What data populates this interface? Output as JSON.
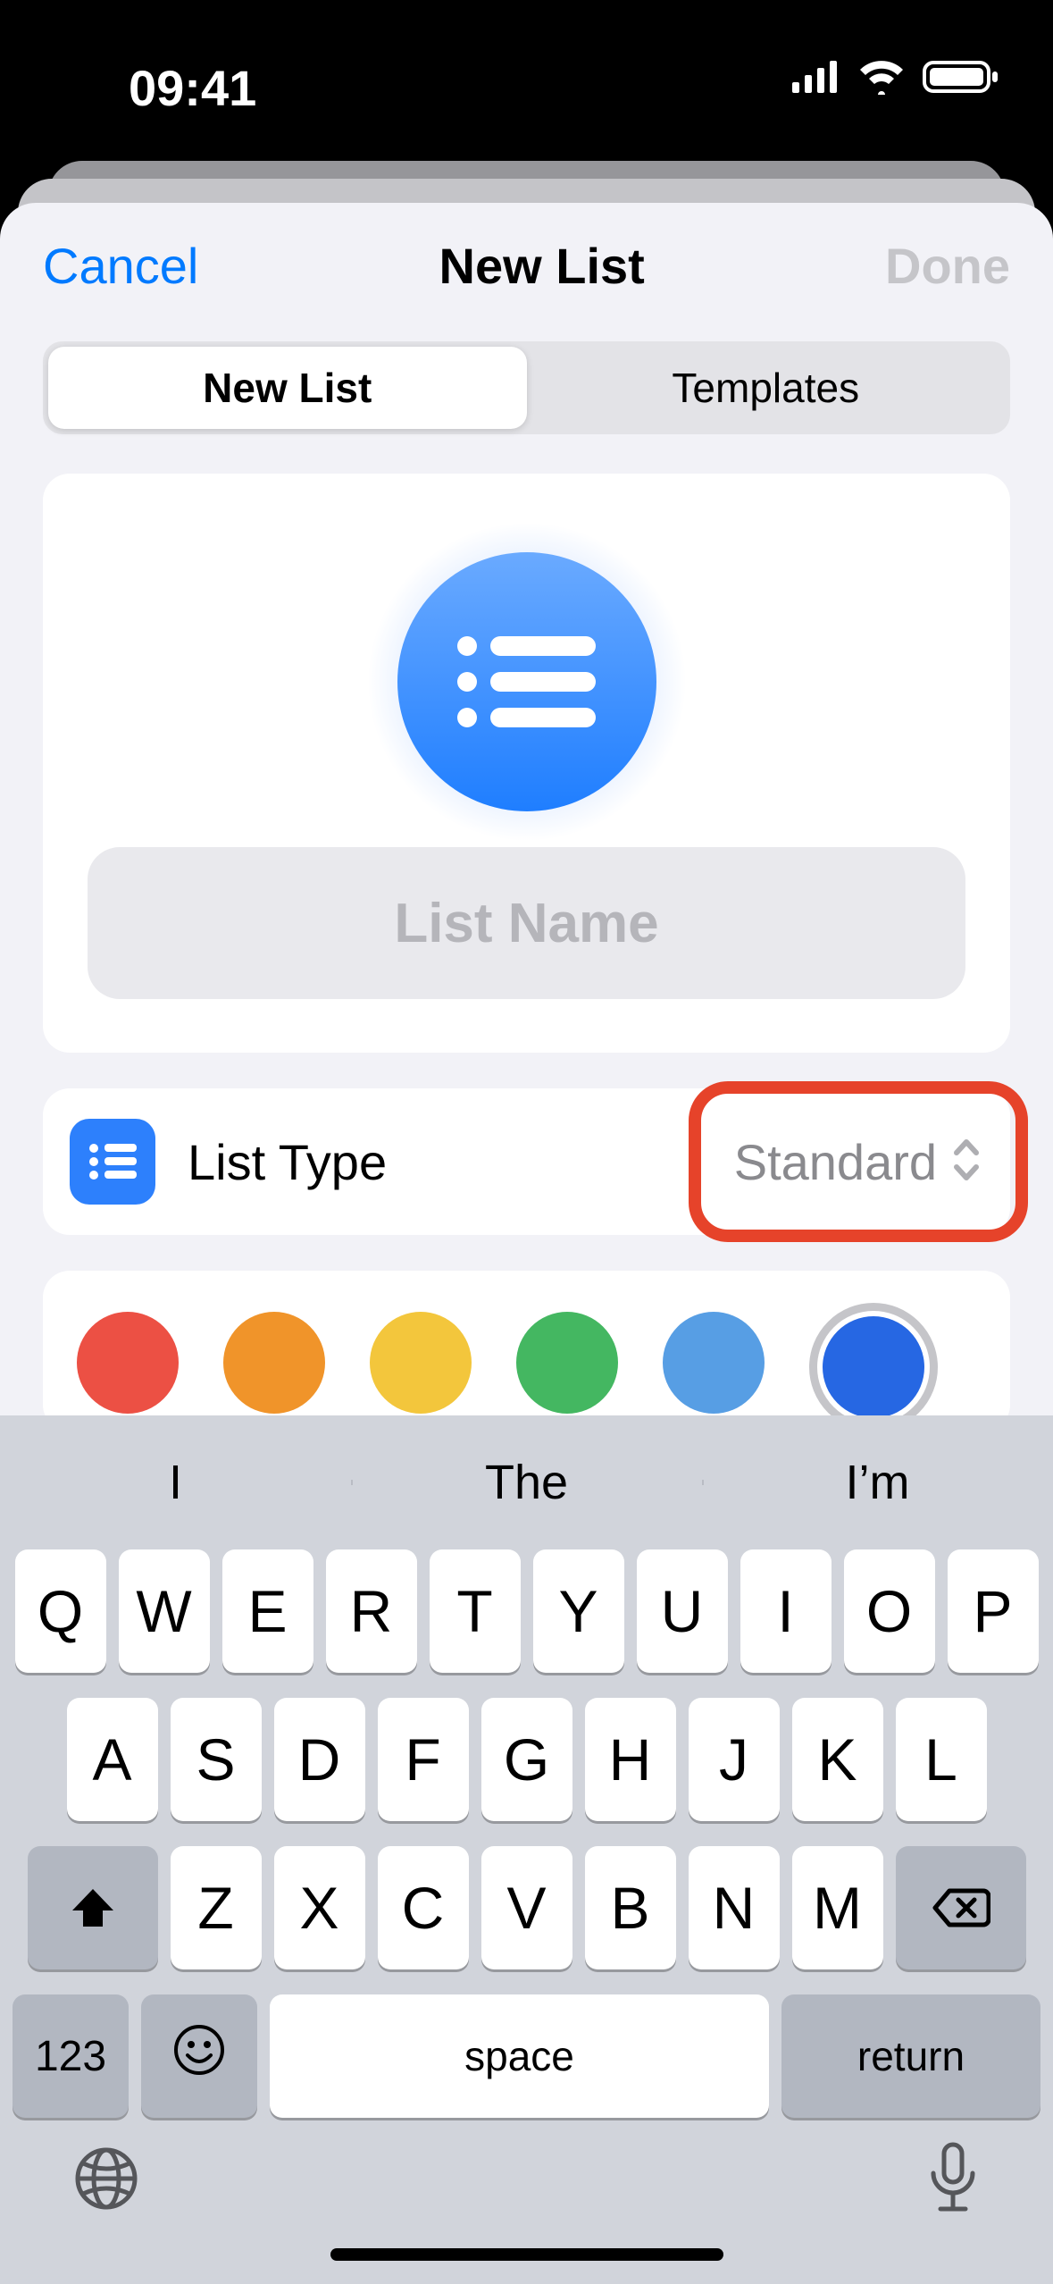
{
  "status": {
    "time": "09:41"
  },
  "nav": {
    "cancel": "Cancel",
    "title": "New List",
    "done": "Done"
  },
  "segments": {
    "new": "New List",
    "templates": "Templates"
  },
  "namefield": {
    "placeholder": "List Name",
    "value": ""
  },
  "listtype": {
    "label": "List Type",
    "value": "Standard"
  },
  "colors": {
    "red": "#ec5044",
    "orange": "#f0942a",
    "yellow": "#f3c63c",
    "green": "#44b761",
    "lightblue": "#579ee4",
    "blue": "#2667e3"
  },
  "suggestions": {
    "a": "I",
    "b": "The",
    "c": "I’m"
  },
  "keys": {
    "r1": [
      "Q",
      "W",
      "E",
      "R",
      "T",
      "Y",
      "U",
      "I",
      "O",
      "P"
    ],
    "r2": [
      "A",
      "S",
      "D",
      "F",
      "G",
      "H",
      "J",
      "K",
      "L"
    ],
    "r3": [
      "Z",
      "X",
      "C",
      "V",
      "B",
      "N",
      "M"
    ],
    "num": "123",
    "space": "space",
    "ret": "return"
  }
}
